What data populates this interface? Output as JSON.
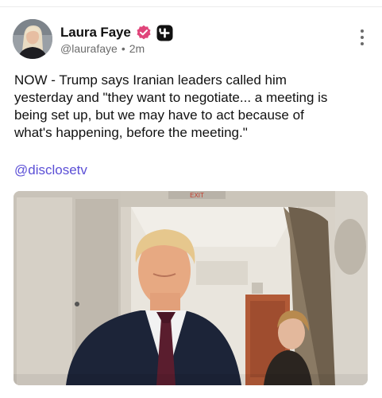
{
  "post": {
    "author": {
      "display_name": "Laura Faye",
      "handle": "@laurafaye",
      "time_ago": "2m",
      "avatar": "profile-photo",
      "verified_icon": "verified-badge-icon",
      "app_badge_icon": "plus-badge-icon"
    },
    "menu_icon": "more-vertical-icon",
    "text_lines": [
      "NOW - Trump says Iranian leaders called him",
      "yesterday and \"they want to negotiate... a meeting is",
      "being set up, but we may have to act because of",
      "what's happening, before the meeting.\""
    ],
    "mention": "@disclosetv",
    "media": {
      "kind": "video-still",
      "sign_text": "EXIT"
    }
  },
  "colors": {
    "link": "#5b4fd6",
    "verified": "#e0457a",
    "meta": "#6b6b6b"
  }
}
